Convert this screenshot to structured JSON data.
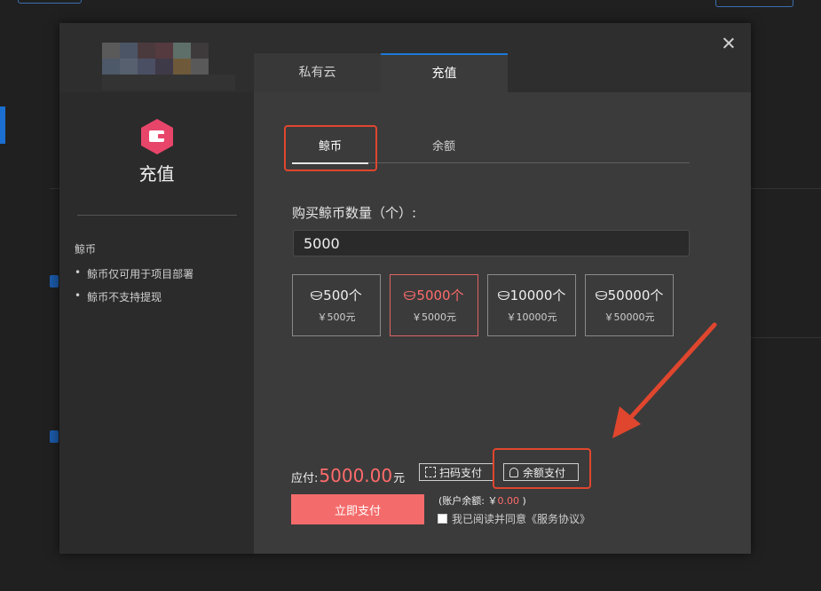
{
  "modal": {
    "top_tabs": [
      {
        "label": "私有云",
        "active": false
      },
      {
        "label": "充值",
        "active": true
      }
    ],
    "left": {
      "title": "充值",
      "heading": "鲸币",
      "notes": [
        "鲸币仅可用于项目部署",
        "鲸币不支持提现"
      ],
      "icon": "wallet-icon",
      "icon_color": "#e8456b"
    },
    "sub_tabs": [
      {
        "label": "鲸币",
        "active": true
      },
      {
        "label": "余额",
        "active": false
      }
    ],
    "quantity": {
      "label": "购买鲸币数量（个）:",
      "value": "5000"
    },
    "packages": [
      {
        "amount": "500个",
        "price": "￥500元",
        "selected": false
      },
      {
        "amount": "5000个",
        "price": "￥5000元",
        "selected": true
      },
      {
        "amount": "10000个",
        "price": "￥10000元",
        "selected": false
      },
      {
        "amount": "50000个",
        "price": "￥50000元",
        "selected": false
      }
    ],
    "payment": {
      "due_label": "应付:",
      "due_amount": "5000.00",
      "due_unit": "元",
      "scan_pay": "扫码支付",
      "balance_pay": "余额支付",
      "pay_now": "立即支付",
      "account_balance_prefix": "(账户余额: ￥",
      "account_balance_value": "0.00",
      "account_balance_suffix": " )",
      "agree_text": "我已阅读并同意《服务协议》"
    },
    "accent_color": "#f46b6b",
    "annotation_color": "#e0462e"
  }
}
